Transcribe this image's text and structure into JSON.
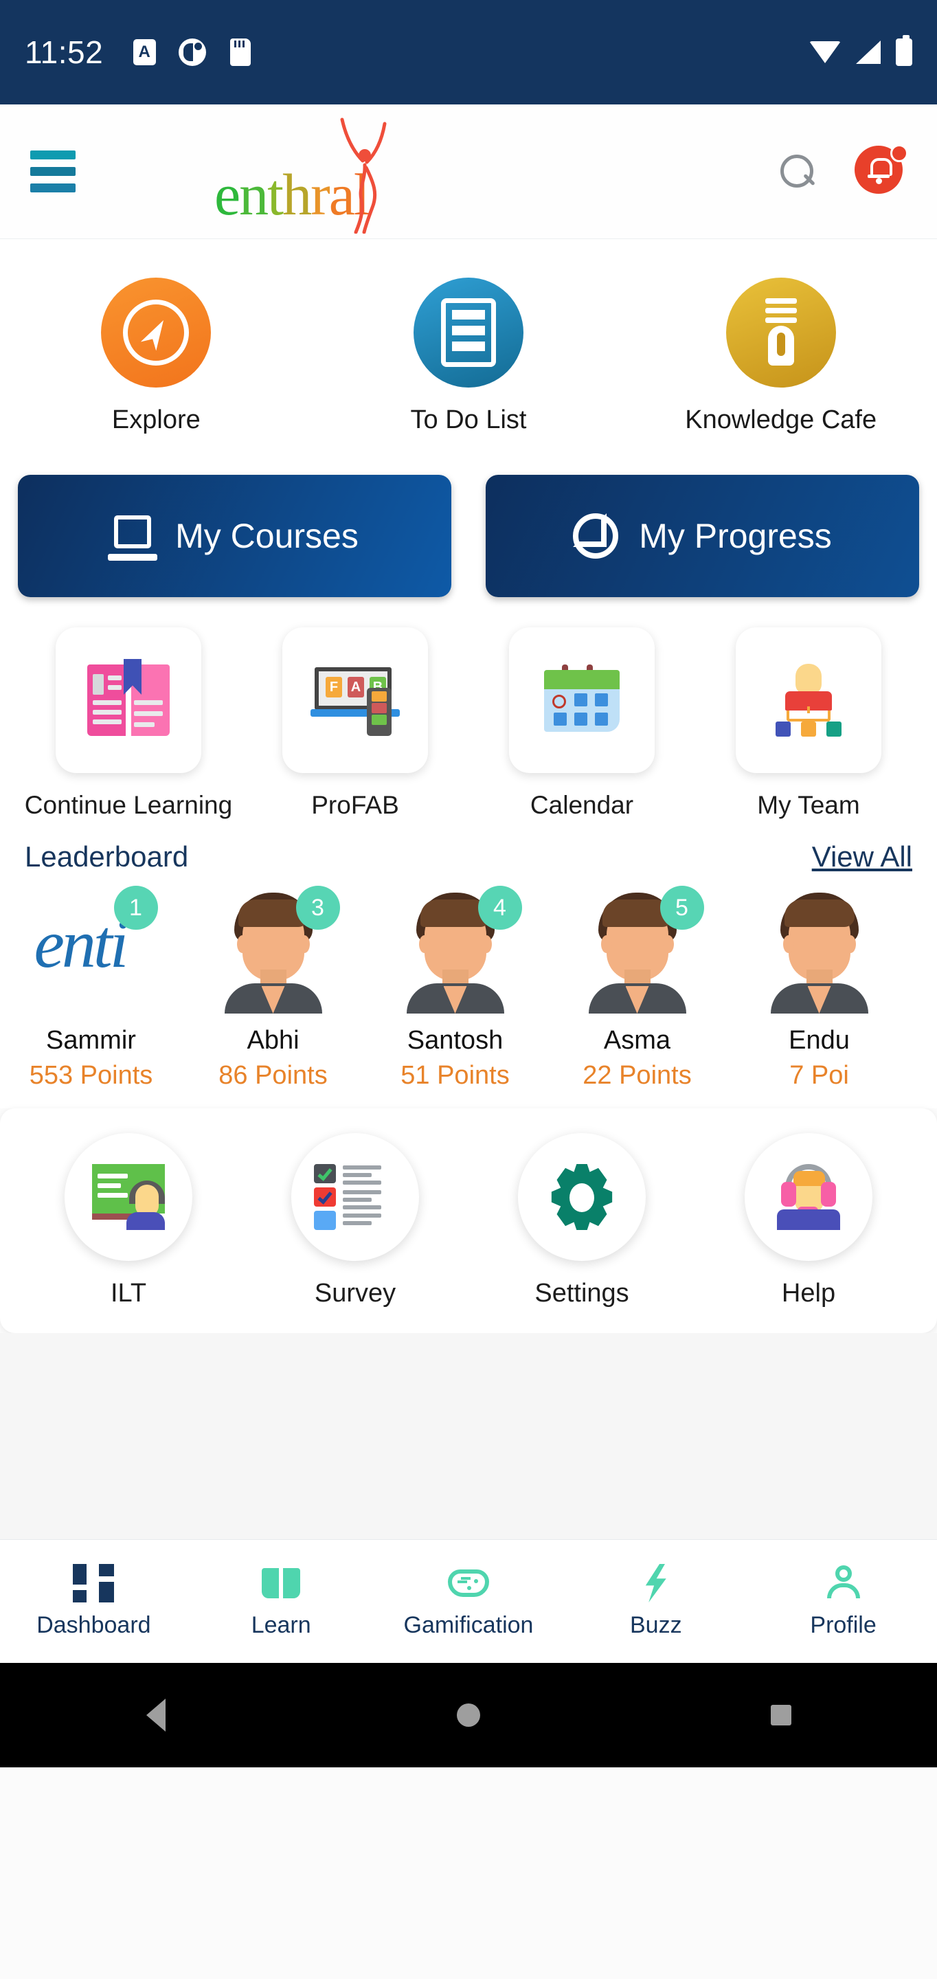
{
  "status_bar": {
    "time": "11:52",
    "left_icons": [
      "font-size-icon",
      "do-not-disturb-icon",
      "sd-card-icon"
    ],
    "right_icons": [
      "wifi-icon",
      "signal-icon",
      "battery-icon"
    ],
    "background_color": "#14355f"
  },
  "app_bar": {
    "menu_icon": "hamburger-menu-icon",
    "logo_text": "enthrall",
    "logo_letters": [
      "e",
      "n",
      "t",
      "h",
      "r",
      "a",
      "l"
    ],
    "search_icon": "search-icon",
    "notification_icon": "bell-icon",
    "notification_has_badge": true,
    "badge_color": "#e8402a"
  },
  "quick_actions": [
    {
      "label": "Explore",
      "icon": "compass-icon",
      "color": "#f2741c"
    },
    {
      "label": "To Do List",
      "icon": "list-icon",
      "color": "#136b94"
    },
    {
      "label": "Knowledge Cafe",
      "icon": "lightbulb-icon",
      "color": "#c6931a"
    }
  ],
  "feature_cards": [
    {
      "label": "My Courses",
      "icon": "laptop-icon"
    },
    {
      "label": "My Progress",
      "icon": "pie-chart-icon"
    }
  ],
  "tiles": [
    {
      "label": "Continue Learning",
      "icon": "open-book-icon"
    },
    {
      "label": "ProFAB",
      "icon": "laptop-phone-fab-icon"
    },
    {
      "label": "Calendar",
      "icon": "calendar-icon"
    },
    {
      "label": "My Team",
      "icon": "org-chart-icon"
    }
  ],
  "leaderboard": {
    "title": "Leaderboard",
    "view_all": "View All",
    "rank_badge_color": "#57d5b4",
    "points_color": "#e8832a",
    "entries": [
      {
        "rank": "1",
        "name": "Sammir",
        "points": "553 Points",
        "avatar": "enti-logo-avatar"
      },
      {
        "rank": "3",
        "name": "Abhi",
        "points": "86 Points",
        "avatar": "person-avatar"
      },
      {
        "rank": "4",
        "name": "Santosh",
        "points": "51 Points",
        "avatar": "person-avatar"
      },
      {
        "rank": "5",
        "name": "Asma",
        "points": "22 Points",
        "avatar": "person-avatar"
      },
      {
        "rank": "",
        "name": "Endu",
        "points": "7 Poi",
        "avatar": "person-avatar"
      }
    ]
  },
  "utility_tiles": [
    {
      "label": "ILT",
      "icon": "classroom-board-icon"
    },
    {
      "label": "Survey",
      "icon": "checklist-icon"
    },
    {
      "label": "Settings",
      "icon": "gear-icon"
    },
    {
      "label": "Help",
      "icon": "headset-support-icon"
    }
  ],
  "bottom_nav": {
    "active": "Dashboard",
    "active_color": "#17365d",
    "inactive_color": "#4fd5ae",
    "items": [
      {
        "label": "Dashboard",
        "icon": "dashboard-grid-icon"
      },
      {
        "label": "Learn",
        "icon": "open-book-icon"
      },
      {
        "label": "Gamification",
        "icon": "gamepad-icon"
      },
      {
        "label": "Buzz",
        "icon": "lightning-bolt-icon"
      },
      {
        "label": "Profile",
        "icon": "person-icon"
      }
    ]
  },
  "android_nav": {
    "items": [
      "back-icon",
      "home-icon",
      "recents-icon"
    ]
  }
}
